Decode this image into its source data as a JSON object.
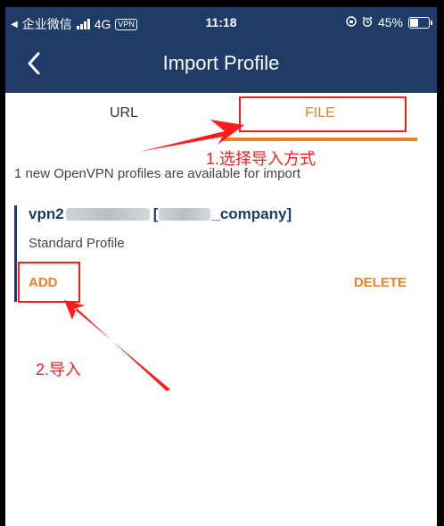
{
  "status_bar": {
    "carrier": "企业微信",
    "network": "4G",
    "vpn_badge": "VPN",
    "time": "11:18",
    "battery": "45%"
  },
  "nav": {
    "title": "Import Profile"
  },
  "tabs": [
    {
      "label": "URL",
      "active": false
    },
    {
      "label": "FILE",
      "active": true
    }
  ],
  "notice": "1 new OpenVPN profiles are available for import",
  "profile": {
    "name_prefix": "vpn2",
    "name_mid": "[",
    "name_suffix": "_company]",
    "type": "Standard Profile",
    "add_label": "ADD",
    "delete_label": "DELETE"
  },
  "annotations": {
    "step1": "1.选择导入方式",
    "step2": "2.导入"
  },
  "colors": {
    "header": "#1f3b67",
    "accent": "#e8832a",
    "annotation": "#ff1b1b"
  }
}
